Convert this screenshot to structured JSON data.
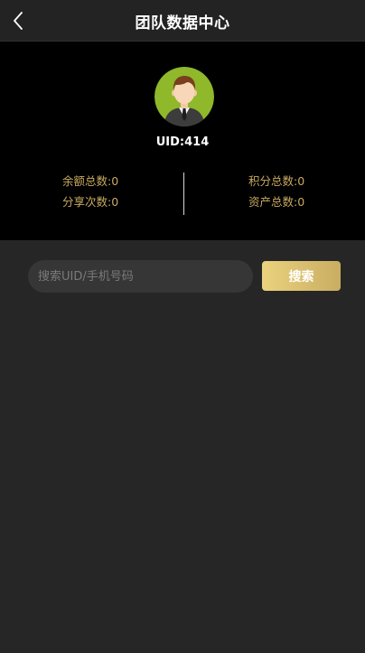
{
  "header": {
    "title": "团队数据中心",
    "back_icon": "chevron-left-icon"
  },
  "profile": {
    "avatar_icon": "user-avatar-icon",
    "uid_text": "UID:414"
  },
  "stats": {
    "balance_total": "余额总数:0",
    "points_total": "积分总数:0",
    "share_count": "分享次数:0",
    "assets_total": "资产总数:0"
  },
  "search": {
    "placeholder": "搜索UID/手机号码",
    "value": "",
    "button_label": "搜索"
  },
  "colors": {
    "background": "#262626",
    "header_bg": "#232323",
    "panel_bg": "#000000",
    "stat_text": "#c9ab62",
    "button_gradient_start": "#ead27e",
    "button_gradient_end": "#c9ad62",
    "input_bg": "#363636",
    "avatar_bg": "#8fb82a"
  }
}
